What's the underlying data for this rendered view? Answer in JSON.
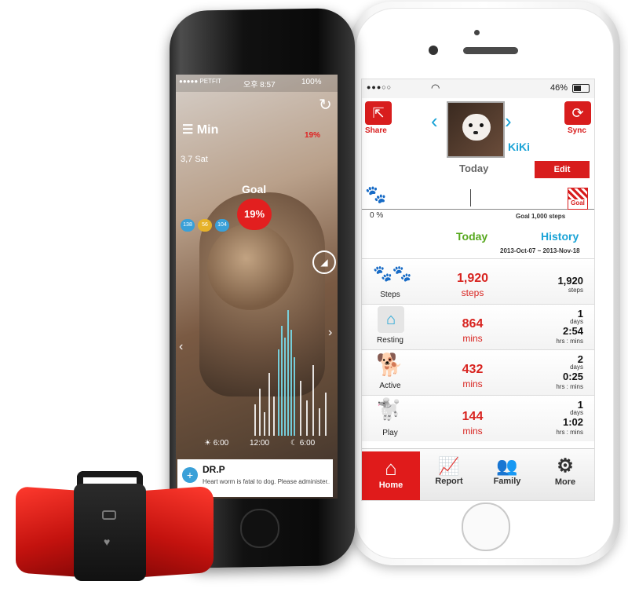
{
  "white_phone": {
    "status_bar": {
      "signal": "●●●○○",
      "battery": "46%"
    },
    "header": {
      "share_label": "Share",
      "sync_label": "Sync",
      "pet_name": "KiKi",
      "today_label": "Today",
      "edit_label": "Edit"
    },
    "progress": {
      "start": "0 %",
      "goal_badge": "Goal",
      "goal_text": "Goal 1,000 steps",
      "value_fraction": 0.0
    },
    "columns": {
      "today": "Today",
      "history": "History",
      "range": "2013-Oct-07 ~ 2013-Nov-18"
    },
    "rows": [
      {
        "label": "Steps",
        "today_value": "1,920",
        "today_unit": "steps",
        "hist_top": "1,920",
        "hist_top_unit": "steps",
        "hist_bottom": "",
        "hist_bottom_unit": ""
      },
      {
        "label": "Resting",
        "today_value": "864",
        "today_unit": "mins",
        "hist_top": "1",
        "hist_top_unit": "days",
        "hist_bottom": "2:54",
        "hist_bottom_unit": "hrs : mins"
      },
      {
        "label": "Active",
        "today_value": "432",
        "today_unit": "mins",
        "hist_top": "2",
        "hist_top_unit": "days",
        "hist_bottom": "0:25",
        "hist_bottom_unit": "hrs : mins"
      },
      {
        "label": "Play",
        "today_value": "144",
        "today_unit": "mins",
        "hist_top": "1",
        "hist_top_unit": "days",
        "hist_bottom": "1:02",
        "hist_bottom_unit": "hrs : mins"
      }
    ],
    "tabs": [
      "Home",
      "Report",
      "Family",
      "More"
    ]
  },
  "black_phone": {
    "status_bar": {
      "carrier": "●●●●● PETFIT",
      "time": "오후 8:57",
      "battery": "100%"
    },
    "menu_label": "Min",
    "battery_pct": "19%",
    "date": "3,7 Sat",
    "goal_label": "Goal",
    "goal_pct": "19%",
    "hearts": [
      "138",
      "56",
      "104"
    ],
    "axis": [
      "6:00",
      "12:00",
      "6:00"
    ],
    "notification": {
      "title": "DR.P",
      "message": "Heart worm is fatal to dog. Please administer..."
    }
  },
  "colors": {
    "accent_red": "#d81d1d",
    "accent_blue": "#1aa3d6",
    "accent_green": "#57a81e"
  }
}
